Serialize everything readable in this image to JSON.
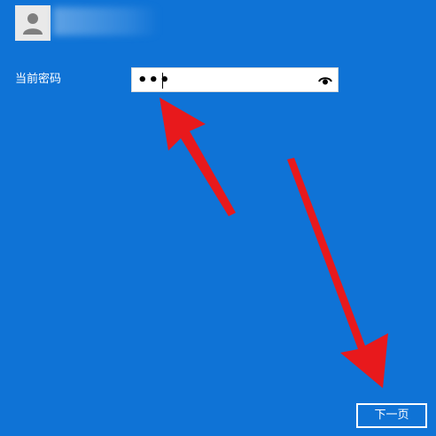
{
  "user": {
    "avatar_icon": "user-avatar-icon"
  },
  "password": {
    "label": "当前密码",
    "value": "•••",
    "reveal_icon": "eye-icon"
  },
  "next_button": {
    "label": "下一页"
  },
  "annotations": {
    "arrow_color": "#e8191c"
  },
  "colors": {
    "background": "#0f73d6",
    "text": "#ffffff",
    "field": "#ffffff"
  }
}
